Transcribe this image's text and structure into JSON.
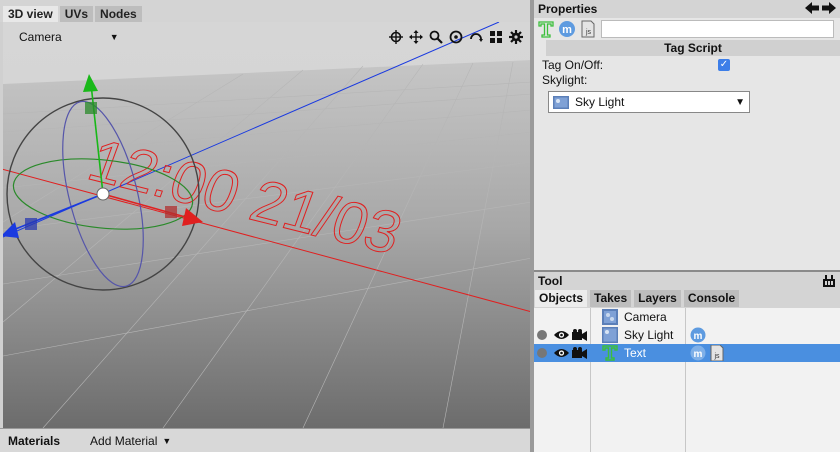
{
  "viewport": {
    "tabs": [
      {
        "label": "3D view"
      },
      {
        "label": "UVs"
      },
      {
        "label": "Nodes"
      }
    ],
    "camera_select": "Camera",
    "scene_text": "12:00 21/03",
    "tool_icons": [
      "target-icon",
      "move-icon",
      "zoom-icon",
      "orbit-icon",
      "rotate-icon",
      "grid-icon",
      "gear-icon"
    ]
  },
  "materials": {
    "title": "Materials",
    "add_label": "Add Material"
  },
  "properties": {
    "title": "Properties",
    "section_title": "Tag Script",
    "tag_on_off_label": "Tag On/Off:",
    "tag_on_off_checked": true,
    "skylight_label": "Skylight:",
    "skylight_value": "Sky Light"
  },
  "tool": {
    "title": "Tool"
  },
  "objects_tabs": [
    {
      "label": "Objects"
    },
    {
      "label": "Takes"
    },
    {
      "label": "Layers"
    },
    {
      "label": "Console"
    }
  ],
  "objects": [
    {
      "name": "Camera",
      "icon": "camera-object-icon",
      "selected": false
    },
    {
      "name": "Sky Light",
      "icon": "sky-light-icon",
      "selected": false
    },
    {
      "name": "Text",
      "icon": "text-object-icon",
      "selected": true
    }
  ],
  "colors": {
    "selection": "#4a8fe0",
    "x_axis": "#e02020",
    "y_axis": "#18b818",
    "z_axis": "#1a3ae0",
    "text_tag": "#3bbf3b"
  }
}
